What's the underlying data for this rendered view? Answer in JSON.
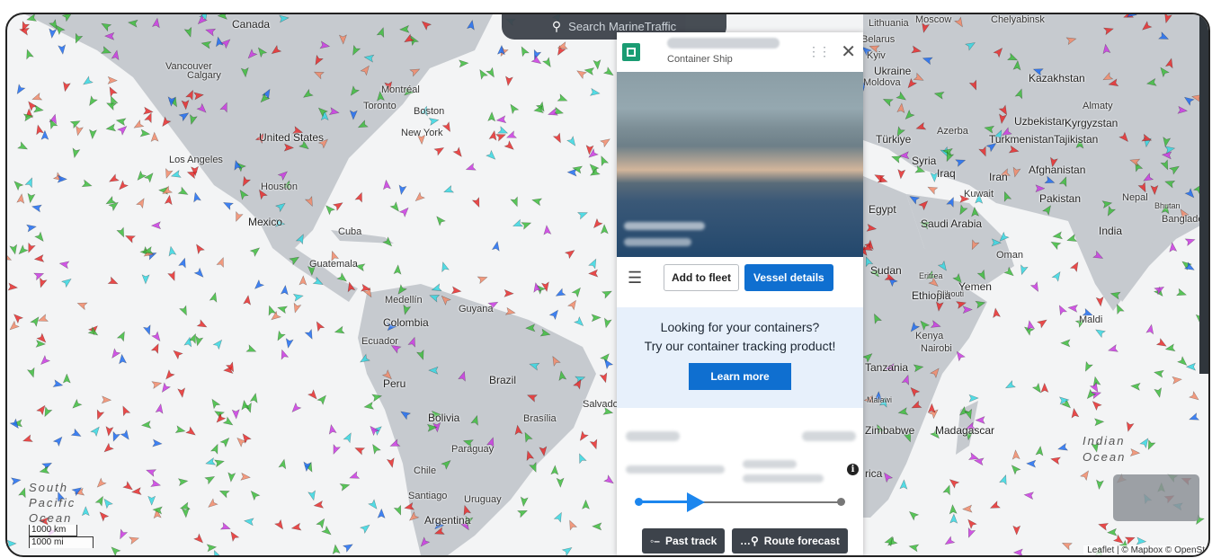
{
  "search": {
    "placeholder": "Search MarineTraffic"
  },
  "map_labels": {
    "canada": "Canada",
    "calgary": "Calgary",
    "vancouver": "Vancouver",
    "united_states": "United States",
    "los_angeles": "Los Angeles",
    "houston": "Houston",
    "mexico": "Mexico",
    "cuba": "Cuba",
    "guatemala": "Guatemala",
    "montreal": "Montréal",
    "toronto": "Toronto",
    "boston": "Boston",
    "new_york": "New York",
    "medellin": "Medellín",
    "guyana": "Guyana",
    "colombia": "Colombia",
    "ecuador": "Ecuador",
    "peru": "Peru",
    "brazil": "Brazil",
    "bolivia": "Bolivia",
    "brasilia": "Brasília",
    "paraguay": "Paraguay",
    "chile": "Chile",
    "santiago": "Santiago",
    "uruguay": "Uruguay",
    "argentina": "Argentina",
    "south_pacific": "South Pacific Ocean",
    "moscow": "Moscow",
    "chelyabinsk": "Chelyabinsk",
    "lithuania": "Lithuania",
    "belarus": "Belarus",
    "kyiv": "Kyiv",
    "ukraine": "Ukraine",
    "moldova": "Moldova",
    "kazakhstan": "Kazakhstan",
    "almaty": "Almaty",
    "uzbekistan": "Uzbekistan",
    "kyrgyzstan": "Kyrgyzstan",
    "turkmenistan": "Turkmenistan",
    "tajikistan": "Tajikistan",
    "turkiye": "Türkiye",
    "azerbaijan": "Azerba",
    "syria": "Syria",
    "iraq": "Iraq",
    "iran": "Iran",
    "afghanistan": "Afghanistan",
    "kuwait": "Kuwait",
    "pakistan": "Pakistan",
    "nepal": "Nepal",
    "bhutan": "Bhutan",
    "egypt": "Egypt",
    "saudi_arabia": "Saudi Arabia",
    "india": "India",
    "bangladesh": "Bangladesh",
    "oman": "Oman",
    "yemen": "Yemen",
    "sudan": "Sudan",
    "eritrea": "Eritrea",
    "djibouti": "Djibouti",
    "ethiopia": "Ethiopia",
    "maldives": "Maldi",
    "kenya": "Kenya",
    "nairobi": "Nairobi",
    "tanzania": "Tanzania",
    "malawi": "Malawi",
    "zimbabwe": "Zimbabwe",
    "madagascar": "Madagascar",
    "indian_ocean": "Indian Ocean",
    "africa": "rica",
    "salvador": "Salvador"
  },
  "vessel": {
    "type": "Container Ship"
  },
  "actions": {
    "add_fleet": "Add to fleet",
    "vessel_details": "Vessel details"
  },
  "promo": {
    "line1": "Looking for your containers?",
    "line2": "Try our container tracking product!",
    "cta": "Learn more"
  },
  "track_buttons": {
    "past": "Past track",
    "forecast": "Route forecast"
  },
  "scale": {
    "km": "1000 km",
    "mi": "1000 mi"
  },
  "attribution": "Leaflet | © Mapbox © OpenSt",
  "colors": {
    "cargo": "#e52c2c",
    "tanker": "#3dbb3d",
    "passenger": "#1e6cf0",
    "other": "#36d6e0",
    "pleasure": "#c93ae0",
    "accent": "#0f6fd0"
  }
}
